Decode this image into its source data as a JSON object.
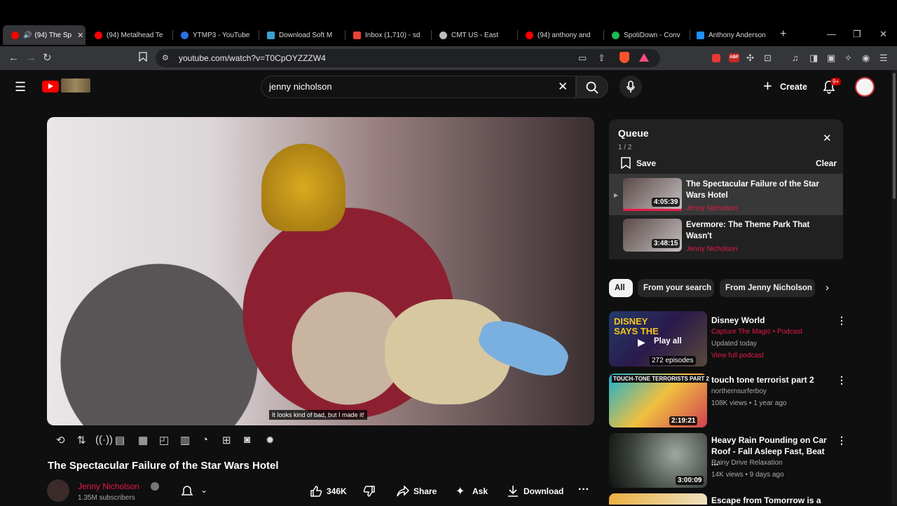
{
  "browser": {
    "tabs": [
      {
        "label": "(94) The Sp",
        "color": "#ff0000"
      },
      {
        "label": "(94) Metalhead Te",
        "color": "#ff0000"
      },
      {
        "label": "YTMP3 - YouTube",
        "color": "#2f6fe0"
      },
      {
        "label": "Download Soft M",
        "color": "#3aa0d0"
      },
      {
        "label": "Inbox (1,710) - sd",
        "color": "#ea4335"
      },
      {
        "label": "CMT US - East",
        "color": "#bbbbbb"
      },
      {
        "label": "(94) anthony and",
        "color": "#ff0000"
      },
      {
        "label": "SpotiDown - Conv",
        "color": "#1db954"
      },
      {
        "label": "Anthony Anderson",
        "color": "#1e90ff"
      }
    ],
    "new_tab": "+",
    "url": "youtube.com/watch?v=T0CpOYZZZW4",
    "window_controls": [
      "minimize",
      "restore",
      "close"
    ]
  },
  "header": {
    "search_value": "jenny nicholson",
    "create_label": "Create",
    "notification_badge": "9+"
  },
  "video": {
    "subtitle": "It looks kind of bad, but I made it!",
    "title": "The Spectacular Failure of the Star Wars Hotel",
    "channel": "Jenny Nicholson",
    "subscribers": "1.35M subscribers",
    "likes": "346K",
    "share_label": "Share",
    "ask_label": "Ask",
    "download_label": "Download"
  },
  "queue": {
    "title": "Queue",
    "position": "1 / 2",
    "save_label": "Save",
    "clear_label": "Clear",
    "items": [
      {
        "title": "The Spectacular Failure of the Star Wars Hotel",
        "channel": "Jenny Nicholson",
        "duration": "4:05:39"
      },
      {
        "title": "Evermore: The Theme Park That Wasn't",
        "channel": "Jenny Nicholson",
        "duration": "3:48:15"
      }
    ]
  },
  "chips": [
    "All",
    "From your search",
    "From Jenny Nicholson"
  ],
  "recommendations": [
    {
      "title": "Disney World",
      "line1": "Capture The Magic",
      "line1b": "Podcast",
      "line2": "Updated today",
      "line3": "View full podcast",
      "overlay": "Play all",
      "badge": "272 episodes"
    },
    {
      "title": "touch tone terrorist part 2",
      "line1": "northernsurferboy",
      "line2": "108K views • 1 year ago",
      "duration": "2:19:21"
    },
    {
      "title": "Heavy Rain Pounding on Car Roof - Fall Asleep Fast, Beat ...",
      "line1": "Rainy Drive Relaxation",
      "line2": "14K views • 9 days ago",
      "duration": "3:00:09"
    },
    {
      "title": "Escape from Tomorrow is a"
    }
  ],
  "colors": {
    "accent": "#e8184a",
    "youtube_red": "#ff0000",
    "background": "#0f0f0f"
  }
}
